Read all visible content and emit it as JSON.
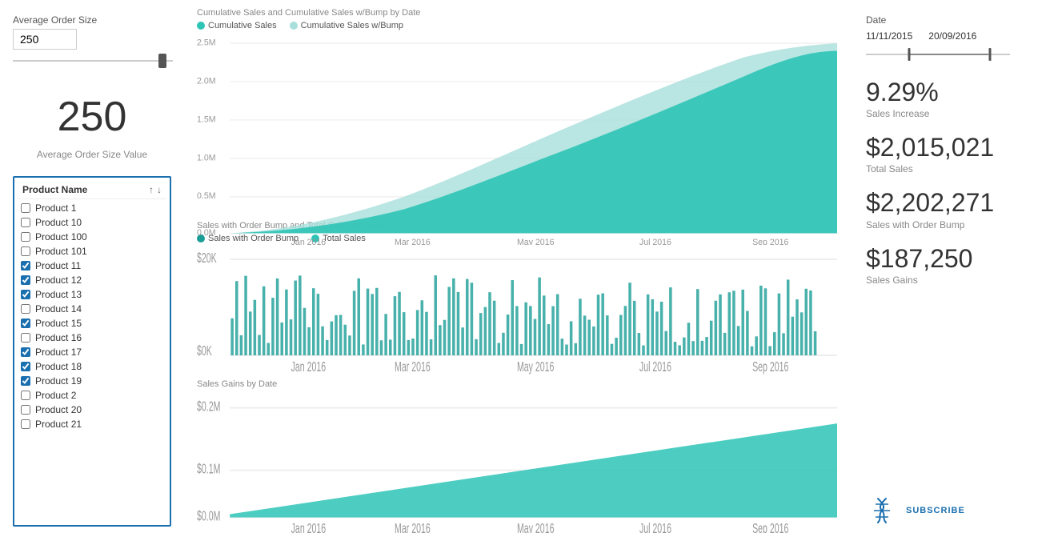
{
  "leftPanel": {
    "avgOrderLabel": "Average Order Size",
    "avgOrderValue": "250",
    "sliderValue": 250,
    "bigNumber": "250",
    "bigNumberLabel": "Average Order Size Value"
  },
  "productList": {
    "title": "Product Name",
    "sortAscIcon": "↑",
    "sortDescIcon": "↓",
    "items": [
      {
        "name": "Product 1",
        "checked": false
      },
      {
        "name": "Product 10",
        "checked": false
      },
      {
        "name": "Product 100",
        "checked": false
      },
      {
        "name": "Product 101",
        "checked": false
      },
      {
        "name": "Product 11",
        "checked": true
      },
      {
        "name": "Product 12",
        "checked": true
      },
      {
        "name": "Product 13",
        "checked": true
      },
      {
        "name": "Product 14",
        "checked": false
      },
      {
        "name": "Product 15",
        "checked": true
      },
      {
        "name": "Product 16",
        "checked": false
      },
      {
        "name": "Product 17",
        "checked": true
      },
      {
        "name": "Product 18",
        "checked": true
      },
      {
        "name": "Product 19",
        "checked": true
      },
      {
        "name": "Product 2",
        "checked": false
      },
      {
        "name": "Product 20",
        "checked": false
      },
      {
        "name": "Product 21",
        "checked": false
      }
    ]
  },
  "charts": {
    "chart1": {
      "title": "Cumulative Sales and Cumulative Sales w/Bump by Date",
      "legend": [
        {
          "label": "Cumulative Sales",
          "color": "#2EC4B6"
        },
        {
          "label": "Cumulative Sales w/Bump",
          "color": "#A8DFDB"
        }
      ],
      "yLabels": [
        "2.5M",
        "2.0M",
        "1.5M",
        "1.0M",
        "0.5M",
        "0.0M"
      ],
      "xLabels": [
        "Jan 2016",
        "Mar 2016",
        "May 2016",
        "Jul 2016",
        "Sep 2016"
      ]
    },
    "chart2": {
      "title": "Sales with Order Bump and Total Sales by Date",
      "legend": [
        {
          "label": "Sales with Order Bump",
          "color": "#1a9e96"
        },
        {
          "label": "Total Sales",
          "color": "#2EC4B6"
        }
      ],
      "yLabels": [
        "$20K",
        "$0K"
      ],
      "xLabels": [
        "Jan 2016",
        "Mar 2016",
        "May 2016",
        "Jul 2016",
        "Sep 2016"
      ]
    },
    "chart3": {
      "title": "Sales Gains by Date",
      "yLabels": [
        "$0.2M",
        "$0.1M",
        "$0.0M"
      ],
      "xLabels": [
        "Jan 2016",
        "Mar 2016",
        "May 2016",
        "Jul 2016",
        "Sep 2016"
      ]
    }
  },
  "rightPanel": {
    "dateLabel": "Date",
    "dateStart": "11/11/2015",
    "dateEnd": "20/09/2016",
    "stats": [
      {
        "value": "9.29%",
        "label": "Sales Increase"
      },
      {
        "value": "$2,015,021",
        "label": "Total Sales"
      },
      {
        "value": "$2,202,271",
        "label": "Sales with Order Bump"
      },
      {
        "value": "$187,250",
        "label": "Sales Gains"
      }
    ],
    "subscribeLabel": "SUBSCRIBE",
    "subscribeColor": "#1a6faf"
  }
}
